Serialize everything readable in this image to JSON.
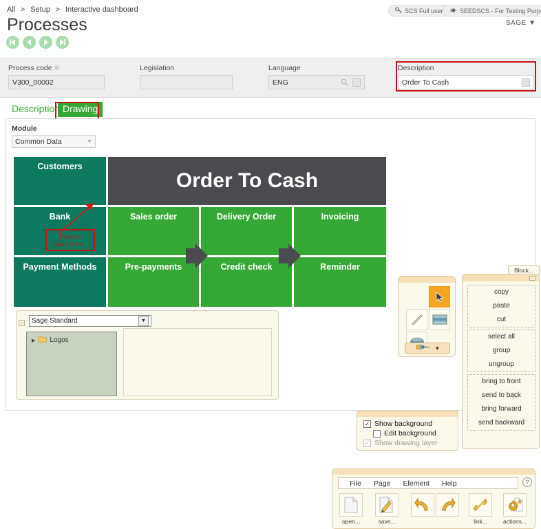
{
  "breadcrumb": {
    "items": [
      "All",
      "Setup",
      "Interactive dashboard"
    ],
    "separator": ">"
  },
  "page": {
    "title": "Processes"
  },
  "nav": {
    "first": "first-record",
    "prev": "previous-record",
    "next": "next-record",
    "last": "last-record"
  },
  "header": {
    "user_pill": "SCS Full user",
    "env_pill": "SEEDSCS - For Testing Purposes",
    "account_menu": "SAGE",
    "account_caret": "▼"
  },
  "form": {
    "process_code": {
      "label": "Process code",
      "required_mark": "✻",
      "value": "V300_00002"
    },
    "legislation": {
      "label": "Legislation",
      "value": ""
    },
    "language": {
      "label": "Language",
      "value": "ENG"
    },
    "description": {
      "label": "Description",
      "value": "Order To Cash",
      "highlight_color": "#cc1111"
    }
  },
  "tabs": {
    "items": [
      {
        "label": "Description",
        "active": false
      },
      {
        "label": "Drawing",
        "active": true
      }
    ],
    "active_highlight_color": "#cc1111",
    "active_bg": "#35a835"
  },
  "module": {
    "label": "Module",
    "value": "Common Data",
    "caret": "▼"
  },
  "diagram": {
    "title": "Order To Cash",
    "colors": {
      "teal": "#0d7a5f",
      "green": "#35a835",
      "dark": "#4b4b4f",
      "arrow": "#4b4b4f"
    },
    "left_column": [
      "Customers",
      "Bank",
      "Payment Methods"
    ],
    "tiles": [
      {
        "label": "Sales order",
        "color": "green"
      },
      {
        "label": "Delivery Order",
        "color": "green"
      },
      {
        "label": "Invoicing",
        "color": "green"
      },
      {
        "label": "Pre-payments",
        "color": "green"
      },
      {
        "label": "Credit check",
        "color": "green"
      },
      {
        "label": "Reminder",
        "color": "green"
      }
    ],
    "annotation": {
      "line1": "Points to",
      "line2": "Sales Order...",
      "color": "#cc1111"
    }
  },
  "library": {
    "select_value": "Sage Standard",
    "collapse_glyph": "–",
    "dropdown_caret": "▼",
    "tree": {
      "expand_glyph": "▶",
      "folder_icon": "folder-icon",
      "label": "Logos"
    }
  },
  "palette": {
    "tools": [
      {
        "name": "cursor-tool",
        "selected": true
      },
      {
        "name": "line-tool",
        "selected": false
      },
      {
        "name": "rectangle-tool",
        "selected": false
      },
      {
        "name": "ellipse-tool",
        "selected": false
      }
    ],
    "pen_caret": "▼"
  },
  "block_panel": {
    "tab_label": "Block...",
    "minimize_glyph": "–",
    "groups": [
      [
        "copy",
        "paste",
        "cut"
      ],
      [
        "select all",
        "group",
        "ungroup"
      ],
      [
        "bring to front",
        "send to back",
        "bring forward",
        "send backward"
      ]
    ]
  },
  "checkboxes": [
    {
      "label": "Show background",
      "checked": true,
      "disabled": false,
      "indent": false,
      "check_glyph": "✓"
    },
    {
      "label": "Edit background",
      "checked": false,
      "disabled": false,
      "indent": true,
      "check_glyph": ""
    },
    {
      "label": "Show drawing layer",
      "checked": true,
      "disabled": true,
      "indent": false,
      "check_glyph": "✓"
    }
  ],
  "toolbar": {
    "menus": [
      "File",
      "Page",
      "Element",
      "Help"
    ],
    "help_glyph": "?",
    "buttons": [
      {
        "name": "open-button",
        "label": "open..."
      },
      {
        "name": "save-button",
        "label": "save..."
      },
      {
        "name": "undo-button",
        "label": ""
      },
      {
        "name": "redo-button",
        "label": ""
      },
      {
        "name": "link-button",
        "label": "link..."
      },
      {
        "name": "actions-button",
        "label": "actions..."
      }
    ]
  }
}
